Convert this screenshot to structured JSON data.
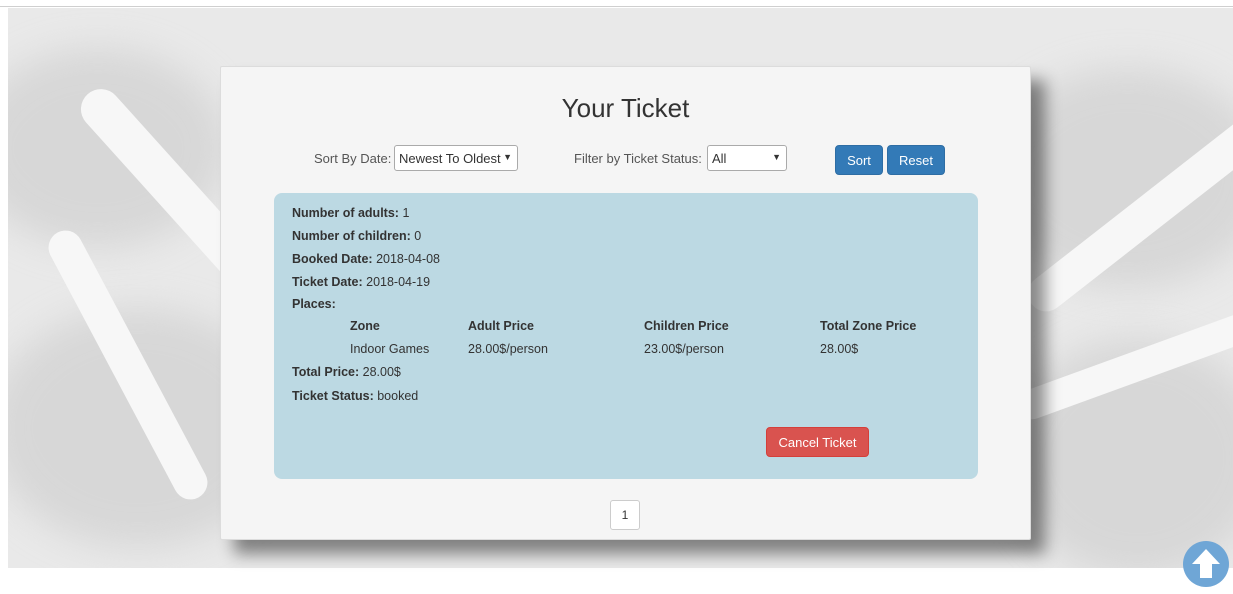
{
  "page": {
    "title": "Your Ticket"
  },
  "controls": {
    "sort_label": "Sort By Date:",
    "sort_value": "Newest To Oldest",
    "filter_label": "Filter by Ticket Status:",
    "filter_value": "All",
    "sort_button": "Sort",
    "reset_button": "Reset"
  },
  "ticket": {
    "adults_label": "Number of adults:",
    "adults_value": "1",
    "children_label": "Number of children:",
    "children_value": "0",
    "booked_label": "Booked Date:",
    "booked_value": "2018-04-08",
    "ticket_date_label": "Ticket Date:",
    "ticket_date_value": "2018-04-19",
    "places_label": "Places:",
    "places_headers": [
      "Zone",
      "Adult Price",
      "Children Price",
      "Total Zone Price"
    ],
    "places_rows": [
      [
        "Indoor Games",
        "28.00$/person",
        "23.00$/person",
        "28.00$"
      ]
    ],
    "total_label": "Total Price:",
    "total_value": "28.00$",
    "status_label": "Ticket Status:",
    "status_value": "booked",
    "cancel_button": "Cancel Ticket"
  },
  "pagination": {
    "current": "1"
  },
  "icons": {
    "scroll_top": "arrow-up-circle-icon"
  },
  "colors": {
    "primary": "#337ab7",
    "danger": "#d9534f",
    "card": "#bcd9e3",
    "scroll_button": "#6fa6d6"
  }
}
